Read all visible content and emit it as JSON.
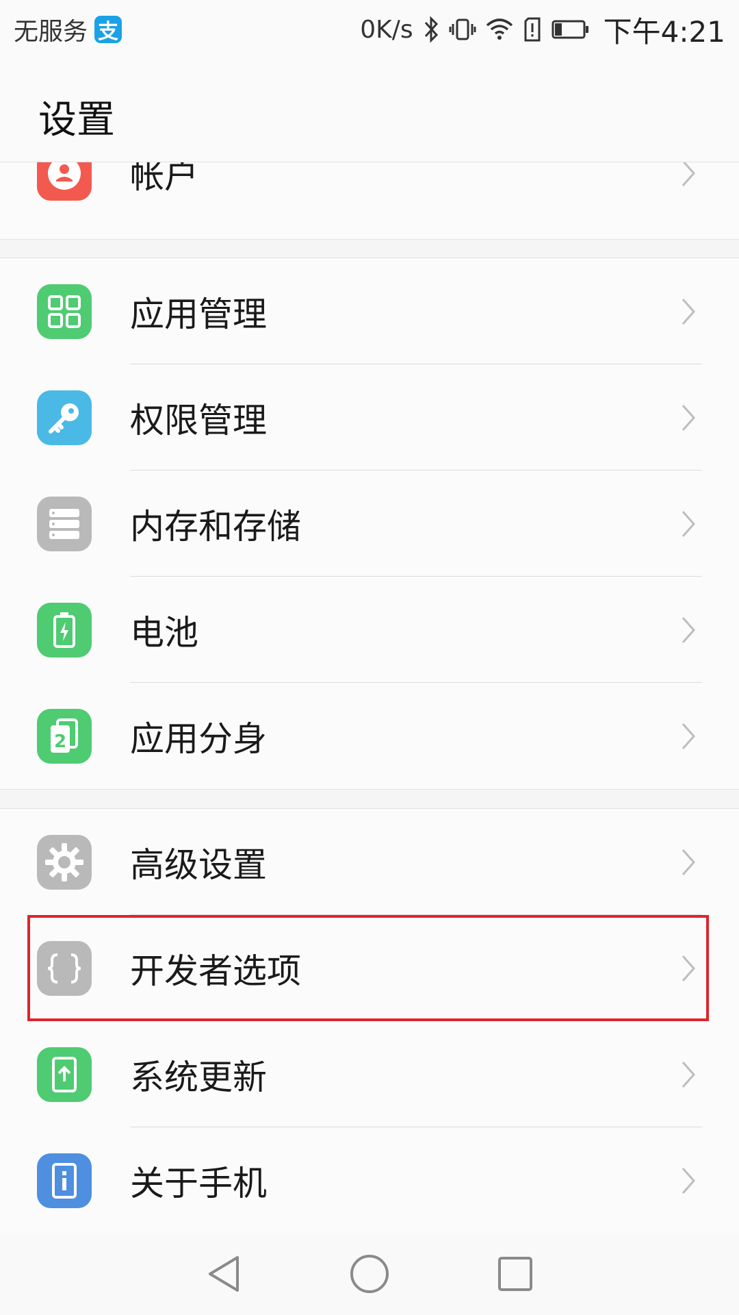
{
  "status_bar": {
    "carrier": "无服务",
    "alipay_icon": "alipay-icon",
    "net_speed": "0K/s",
    "time": "下午4:21"
  },
  "header": {
    "title": "设置"
  },
  "groups": [
    {
      "items": [
        {
          "label": "帐户",
          "icon": "account-icon",
          "color": "#f35a4f"
        }
      ]
    },
    {
      "items": [
        {
          "label": "应用管理",
          "icon": "apps-grid-icon",
          "color": "#4fcb72"
        },
        {
          "label": "权限管理",
          "icon": "key-icon",
          "color": "#4ab9e6"
        },
        {
          "label": "内存和存储",
          "icon": "storage-icon",
          "color": "#b9b9b9"
        },
        {
          "label": "电池",
          "icon": "battery-icon",
          "color": "#4fcb72"
        },
        {
          "label": "应用分身",
          "icon": "app-twin-icon",
          "color": "#4fcb72"
        }
      ]
    },
    {
      "items": [
        {
          "label": "高级设置",
          "icon": "gear-icon",
          "color": "#b9b9b9"
        },
        {
          "label": "开发者选项",
          "icon": "braces-icon",
          "color": "#b9b9b9",
          "highlighted": true
        },
        {
          "label": "系统更新",
          "icon": "system-update-icon",
          "color": "#4fcb72"
        },
        {
          "label": "关于手机",
          "icon": "info-icon",
          "color": "#4e8fe0"
        }
      ]
    }
  ],
  "highlight_color": "#e0232b",
  "nav_bar": {
    "back": "back-triangle-icon",
    "home": "home-circle-icon",
    "recents": "recents-square-icon"
  }
}
